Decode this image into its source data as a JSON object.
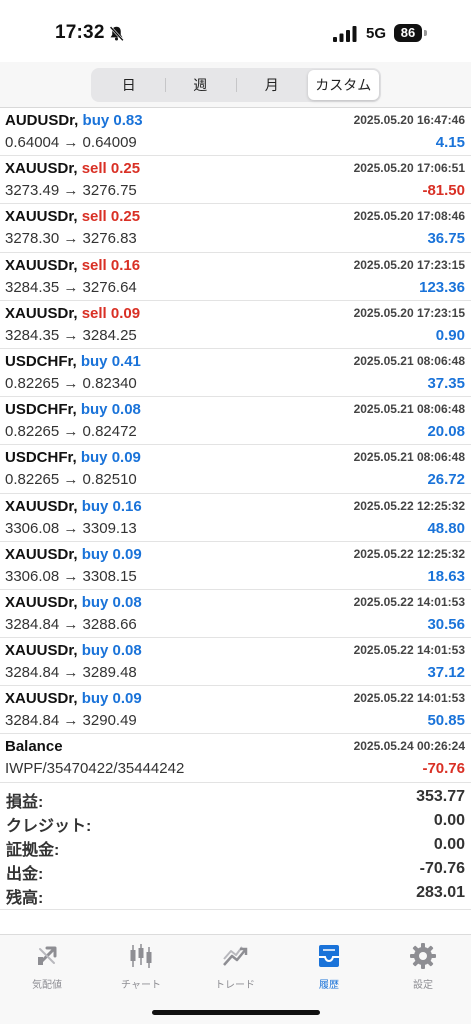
{
  "status_bar": {
    "time": "17:32",
    "network": "5G",
    "battery": "86"
  },
  "period_tabs": [
    {
      "label": "日",
      "active": false
    },
    {
      "label": "週",
      "active": false
    },
    {
      "label": "月",
      "active": false
    },
    {
      "label": "カスタム",
      "active": true
    }
  ],
  "trades": [
    {
      "symbol": "AUDUSDr,",
      "type": "buy 0.83",
      "side": "buy",
      "date": "2025.05.20 16:47:46",
      "prices": "0.64004 → 0.64009",
      "profit": "4.15",
      "sign": "pos"
    },
    {
      "symbol": "XAUUSDr,",
      "type": "sell 0.25",
      "side": "sell",
      "date": "2025.05.20 17:06:51",
      "prices": "3273.49 → 3276.75",
      "profit": "-81.50",
      "sign": "neg"
    },
    {
      "symbol": "XAUUSDr,",
      "type": "sell 0.25",
      "side": "sell",
      "date": "2025.05.20 17:08:46",
      "prices": "3278.30 → 3276.83",
      "profit": "36.75",
      "sign": "pos"
    },
    {
      "symbol": "XAUUSDr,",
      "type": "sell 0.16",
      "side": "sell",
      "date": "2025.05.20 17:23:15",
      "prices": "3284.35 → 3276.64",
      "profit": "123.36",
      "sign": "pos"
    },
    {
      "symbol": "XAUUSDr,",
      "type": "sell 0.09",
      "side": "sell",
      "date": "2025.05.20 17:23:15",
      "prices": "3284.35 → 3284.25",
      "profit": "0.90",
      "sign": "pos"
    },
    {
      "symbol": "USDCHFr,",
      "type": "buy 0.41",
      "side": "buy",
      "date": "2025.05.21 08:06:48",
      "prices": "0.82265 → 0.82340",
      "profit": "37.35",
      "sign": "pos"
    },
    {
      "symbol": "USDCHFr,",
      "type": "buy 0.08",
      "side": "buy",
      "date": "2025.05.21 08:06:48",
      "prices": "0.82265 → 0.82472",
      "profit": "20.08",
      "sign": "pos"
    },
    {
      "symbol": "USDCHFr,",
      "type": "buy 0.09",
      "side": "buy",
      "date": "2025.05.21 08:06:48",
      "prices": "0.82265 → 0.82510",
      "profit": "26.72",
      "sign": "pos"
    },
    {
      "symbol": "XAUUSDr,",
      "type": "buy 0.16",
      "side": "buy",
      "date": "2025.05.22 12:25:32",
      "prices": "3306.08 → 3309.13",
      "profit": "48.80",
      "sign": "pos"
    },
    {
      "symbol": "XAUUSDr,",
      "type": "buy 0.09",
      "side": "buy",
      "date": "2025.05.22 12:25:32",
      "prices": "3306.08 → 3308.15",
      "profit": "18.63",
      "sign": "pos"
    },
    {
      "symbol": "XAUUSDr,",
      "type": "buy 0.08",
      "side": "buy",
      "date": "2025.05.22 14:01:53",
      "prices": "3284.84 → 3288.66",
      "profit": "30.56",
      "sign": "pos"
    },
    {
      "symbol": "XAUUSDr,",
      "type": "buy 0.08",
      "side": "buy",
      "date": "2025.05.22 14:01:53",
      "prices": "3284.84 → 3289.48",
      "profit": "37.12",
      "sign": "pos"
    },
    {
      "symbol": "XAUUSDr,",
      "type": "buy 0.09",
      "side": "buy",
      "date": "2025.05.22 14:01:53",
      "prices": "3284.84 → 3290.49",
      "profit": "50.85",
      "sign": "pos"
    },
    {
      "symbol": "Balance",
      "type": "",
      "side": "",
      "date": "2025.05.24 00:26:24",
      "prices": "IWPF/35470422/35444242",
      "profit": "-70.76",
      "sign": "neg"
    }
  ],
  "summary": [
    {
      "label": "損益:",
      "value": "353.77"
    },
    {
      "label": "クレジット:",
      "value": "0.00"
    },
    {
      "label": "証拠金:",
      "value": "0.00"
    },
    {
      "label": "出金:",
      "value": "-70.76"
    },
    {
      "label": "残高:",
      "value": "283.01"
    }
  ],
  "tab_bar": [
    {
      "label": "気配値",
      "icon": "quotes-icon",
      "active": false
    },
    {
      "label": "チャート",
      "icon": "chart-icon",
      "active": false
    },
    {
      "label": "トレード",
      "icon": "trade-icon",
      "active": false
    },
    {
      "label": "履歴",
      "icon": "history-icon",
      "active": true
    },
    {
      "label": "設定",
      "icon": "settings-icon",
      "active": false
    }
  ],
  "colors": {
    "buy": "#1a73d9",
    "sell": "#d93025",
    "active_tab": "#1a73d9",
    "inactive_tab": "#8e8e93"
  }
}
